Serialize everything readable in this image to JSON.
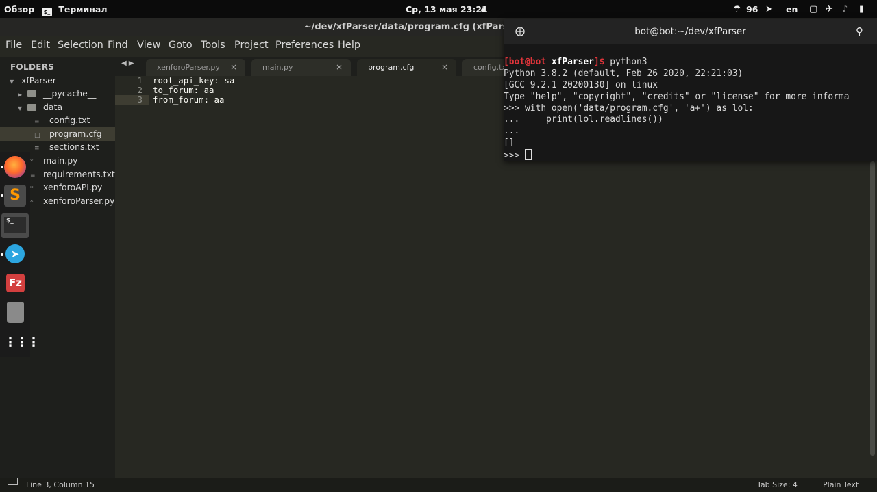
{
  "gnome_bar": {
    "activities": "Обзор",
    "app_name": "Терминал",
    "clock": "Ср, 13 мая  23:21",
    "battery_level": "96",
    "keyboard_layout": "en"
  },
  "sublime": {
    "window_title": "~/dev/xfParser/data/program.cfg (xfParser) - Sublime",
    "menu": [
      "File",
      "Edit",
      "Selection",
      "Find",
      "View",
      "Goto",
      "Tools",
      "Project",
      "Preferences",
      "Help"
    ],
    "sidebar": {
      "heading": "FOLDERS",
      "root": "xfParser",
      "items": [
        {
          "label": "__pycache__",
          "kind": "folder",
          "expanded": false
        },
        {
          "label": "data",
          "kind": "folder",
          "expanded": true
        },
        {
          "label": "config.txt",
          "kind": "file"
        },
        {
          "label": "program.cfg",
          "kind": "file",
          "selected": true
        },
        {
          "label": "sections.txt",
          "kind": "file"
        },
        {
          "label": "main.py",
          "kind": "file"
        },
        {
          "label": "requirements.txt",
          "kind": "file"
        },
        {
          "label": "xenforoAPI.py",
          "kind": "file"
        },
        {
          "label": "xenforoParser.py",
          "kind": "file"
        }
      ]
    },
    "tabs": [
      {
        "label": "xenforoParser.py",
        "active": false
      },
      {
        "label": "main.py",
        "active": false
      },
      {
        "label": "program.cfg",
        "active": true
      },
      {
        "label": "config.tx",
        "active": false
      }
    ],
    "tab_close_glyph": "×",
    "editor": {
      "lines": [
        {
          "num": "1",
          "text": "root_api_key: sa"
        },
        {
          "num": "2",
          "text": "to_forum: aa"
        },
        {
          "num": "3",
          "text": "from_forum: aa"
        }
      ]
    },
    "status": {
      "position": "Line 3, Column 15",
      "tab_size": "Tab Size: 4",
      "syntax": "Plain Text"
    }
  },
  "terminal": {
    "title": "bot@bot:~/dev/xfParser",
    "prompt_bracket_open": "[",
    "prompt_user": "bot@bot",
    "prompt_dir": "xfParser",
    "prompt_bracket_close": "]$",
    "command": " python3",
    "output": [
      "Python 3.8.2 (default, Feb 26 2020, 22:21:03)",
      "[GCC 9.2.1 20200130] on linux",
      "Type \"help\", \"copyright\", \"credits\" or \"license\" for more informa",
      ">>> with open('data/program.cfg', 'a+') as lol:",
      "...     print(lol.readlines())",
      "...",
      "[]"
    ],
    "current_prompt": ">>> "
  },
  "dock": [
    "firefox-icon",
    "sublime-text-icon",
    "terminal-icon",
    "telegram-icon",
    "filezilla-icon",
    "trash-icon",
    "app-grid-icon"
  ],
  "colors": {
    "editor_bg": "#272822",
    "sidebar_bg": "#1e1f1c",
    "terminal_bg": "#171717",
    "prompt_red": "#e0343a"
  }
}
